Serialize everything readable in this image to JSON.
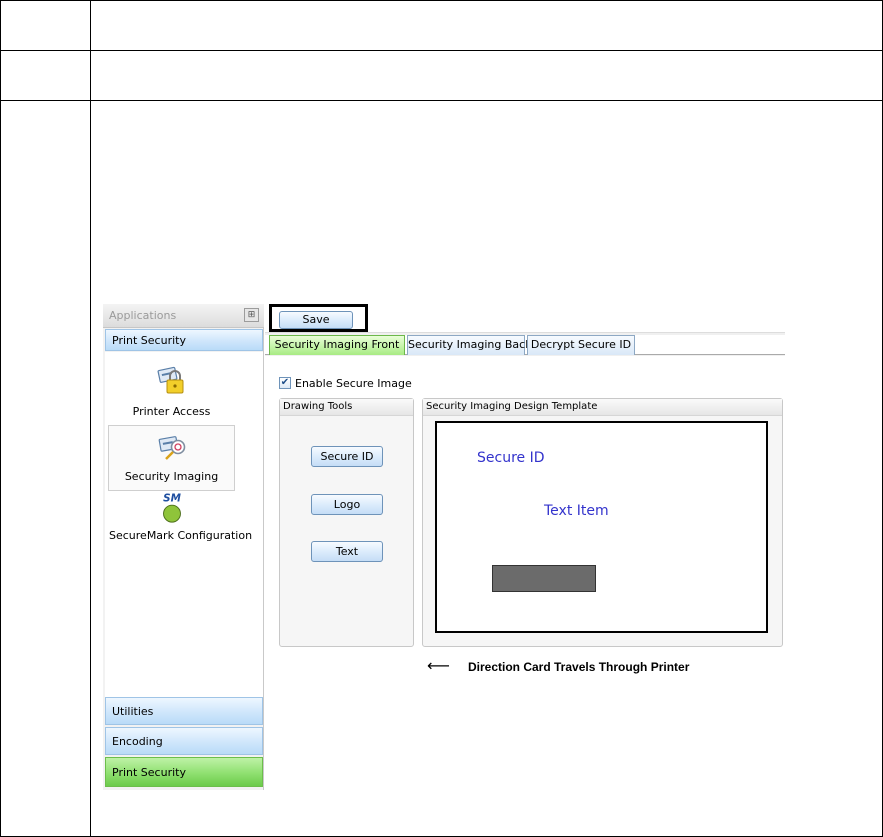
{
  "sidebar": {
    "header": "Applications",
    "top_category": "Print Security",
    "items": [
      {
        "label": "Printer Access",
        "icon": "lock-card-icon"
      },
      {
        "label": "Security Imaging",
        "icon": "security-imaging-icon"
      },
      {
        "label": "SecureMark Configuration",
        "icon": "securemark-icon",
        "badge": "SM"
      }
    ],
    "categories": [
      "Utilities",
      "Encoding",
      "Print Security"
    ],
    "pin_glyph": "⊞"
  },
  "toolbar": {
    "save_label": "Save"
  },
  "tabs": [
    {
      "label": "Security Imaging Front",
      "active": true
    },
    {
      "label": "Security Imaging Back",
      "active": false
    },
    {
      "label": "Decrypt Secure ID",
      "active": false
    }
  ],
  "enable_secure_image": {
    "label": "Enable Secure Image",
    "checked": true
  },
  "drawing_tools": {
    "title": "Drawing Tools",
    "buttons": [
      "Secure ID",
      "Logo",
      "Text"
    ]
  },
  "design_template": {
    "title": "Security Imaging Design Template",
    "secure_id_text": "Secure ID",
    "text_item_text": "Text Item"
  },
  "direction": {
    "arrow": "⟵",
    "label": "Direction Card Travels Through Printer"
  },
  "colors": {
    "active_tab": "#a8eb84",
    "card_text": "#3333cc",
    "logo_fill": "#6b6b6b"
  }
}
